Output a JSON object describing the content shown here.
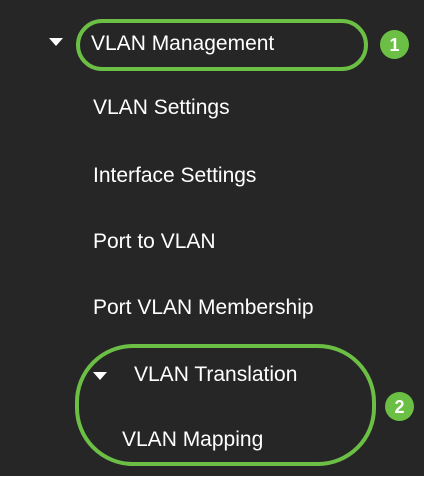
{
  "menu": {
    "vlan_management": "VLAN Management",
    "vlan_settings": "VLAN Settings",
    "interface_settings": "Interface Settings",
    "port_to_vlan": "Port to VLAN",
    "port_vlan_membership": "Port VLAN Membership",
    "vlan_translation": "VLAN Translation",
    "vlan_mapping": "VLAN Mapping"
  },
  "callouts": {
    "badge_1": "1",
    "badge_2": "2"
  },
  "colors": {
    "panel_background": "#262626",
    "text": "#ffffff",
    "highlight": "#6cbf45"
  },
  "icons": {
    "expand_caret": "caret-down-icon"
  }
}
